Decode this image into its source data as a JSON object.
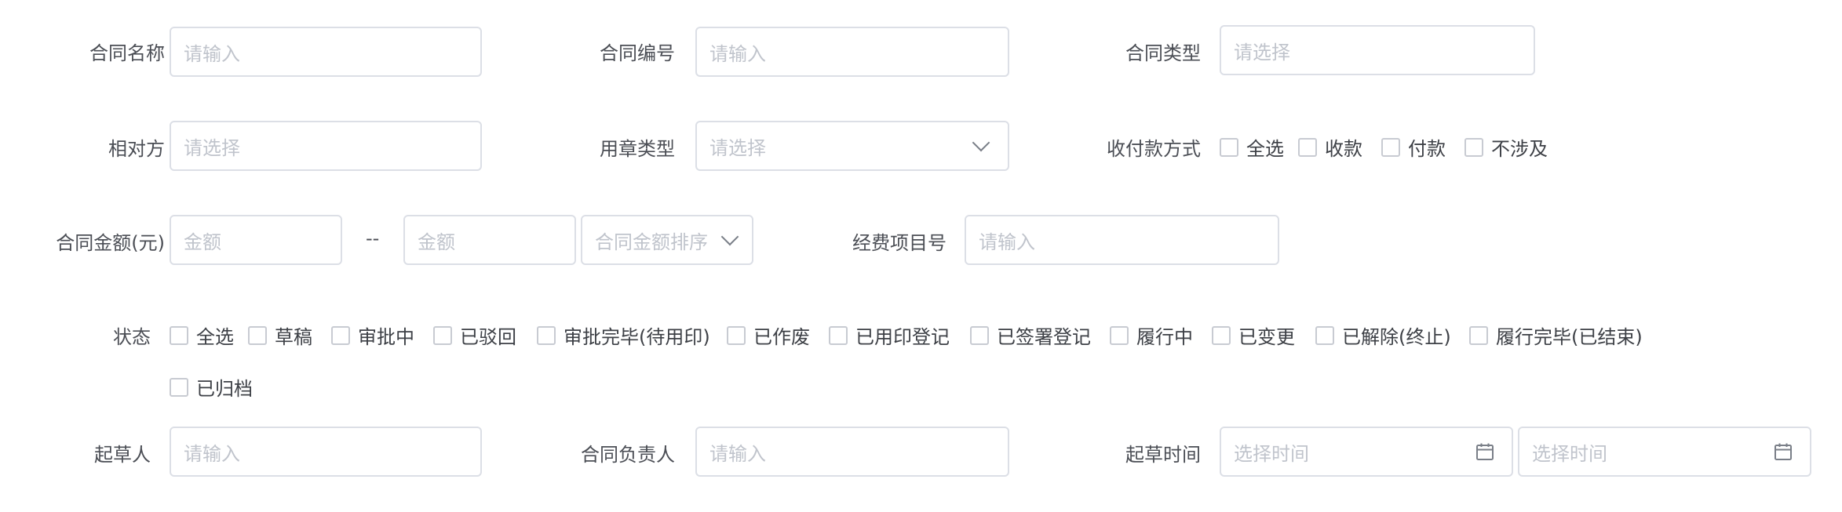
{
  "row1": {
    "contract_name": {
      "label": "合同名称",
      "placeholder": "请输入"
    },
    "contract_no": {
      "label": "合同编号",
      "placeholder": "请输入"
    },
    "contract_type": {
      "label": "合同类型",
      "placeholder": "请选择"
    }
  },
  "row2": {
    "counterparty": {
      "label": "相对方",
      "placeholder": "请选择"
    },
    "seal_type": {
      "label": "用章类型",
      "placeholder": "请选择"
    },
    "payment_method": {
      "label": "收付款方式",
      "options": [
        "全选",
        "收款",
        "付款",
        "不涉及"
      ]
    }
  },
  "row3": {
    "amount": {
      "label": "合同金额(元)",
      "min_placeholder": "金额",
      "separator": "--",
      "max_placeholder": "金额",
      "sort_placeholder": "合同金额排序"
    },
    "project_no": {
      "label": "经费项目号",
      "placeholder": "请输入"
    }
  },
  "status": {
    "label": "状态",
    "options": [
      "全选",
      "草稿",
      "审批中",
      "已驳回",
      "审批完毕(待用印)",
      "已作废",
      "已用印登记",
      "已签署登记",
      "履行中",
      "已变更",
      "已解除(终止)",
      "履行完毕(已结束)",
      "已归档"
    ]
  },
  "row5": {
    "drafter": {
      "label": "起草人",
      "placeholder": "请输入"
    },
    "owner": {
      "label": "合同负责人",
      "placeholder": "请输入"
    },
    "draft_time": {
      "label": "起草时间",
      "start_placeholder": "选择时间",
      "end_placeholder": "选择时间"
    }
  },
  "icons": {
    "dropdown": "chevron-down-icon",
    "date": "calendar-icon"
  }
}
